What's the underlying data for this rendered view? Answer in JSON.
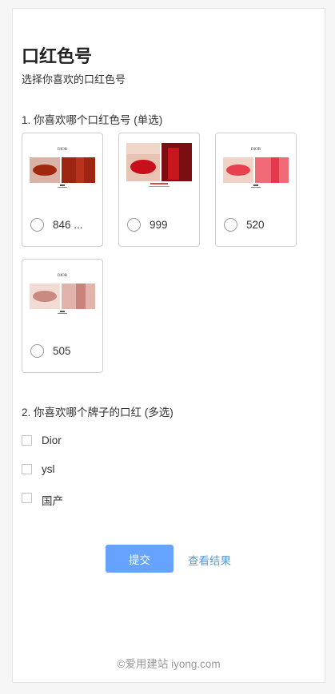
{
  "page": {
    "title": "口红色号",
    "subtitle": "选择你喜欢的口红色号"
  },
  "question1": {
    "label": "1. 你喜欢哪个口红色号 (单选)",
    "options": [
      {
        "label": "846 ...",
        "image_caption": "DIOR"
      },
      {
        "label": "999",
        "image_caption": ""
      },
      {
        "label": "520",
        "image_caption": "DIOR"
      },
      {
        "label": "505",
        "image_caption": "DIOR"
      }
    ]
  },
  "question2": {
    "label": "2. 你喜欢哪个牌子的口红 (多选)",
    "options": [
      {
        "label": "Dior"
      },
      {
        "label": "ysl"
      },
      {
        "label": "国产"
      }
    ]
  },
  "actions": {
    "submit_label": "提交",
    "results_label": "查看结果"
  },
  "footer": {
    "text": "©爱用建站 iyong.com"
  },
  "colors": {
    "accent": "#66a3ff",
    "link": "#5b9bd5",
    "border": "#cfcfcf"
  }
}
